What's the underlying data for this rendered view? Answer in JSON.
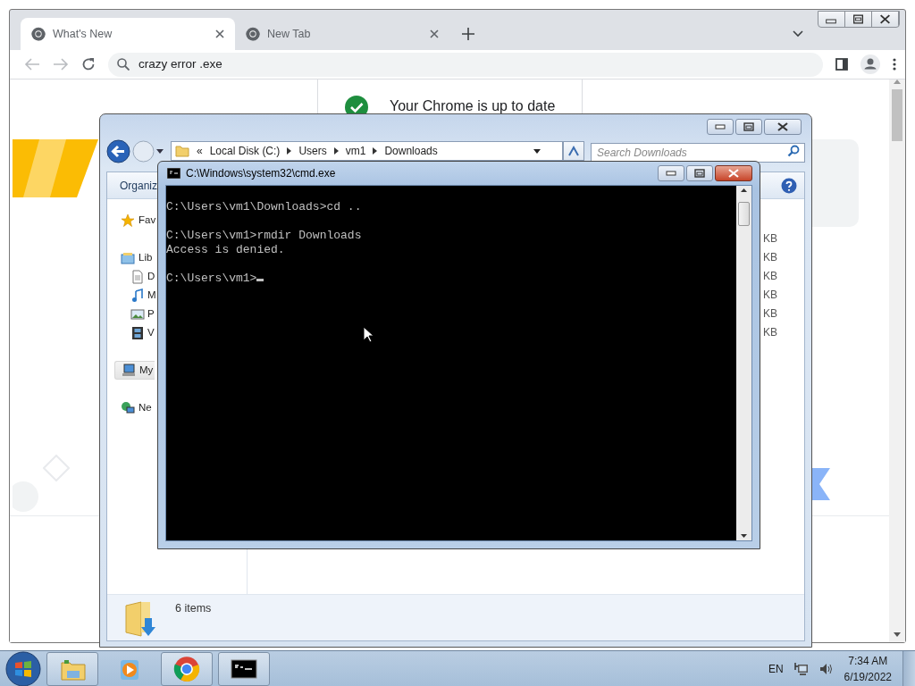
{
  "chrome": {
    "tabs": [
      {
        "label": "What's New",
        "selected": true
      },
      {
        "label": "New Tab",
        "selected": false
      }
    ],
    "omnibox": "crazy error .exe",
    "update_status": "Your Chrome is up to date"
  },
  "explorer": {
    "breadcrumb_overflow": "«",
    "breadcrumb": [
      "Local Disk (C:)",
      "Users",
      "vm1",
      "Downloads"
    ],
    "search": {
      "placeholder": "Search Downloads"
    },
    "toolbar": "Organiz",
    "nav": [
      {
        "label": "Fav",
        "kind": "star",
        "selected": false
      },
      {
        "label": "Lib",
        "kind": "library",
        "selected": false,
        "children": [
          {
            "label": "D",
            "kind": "document",
            "selected": false
          },
          {
            "label": "M",
            "kind": "music",
            "selected": false
          },
          {
            "label": "P",
            "kind": "picture",
            "selected": false
          },
          {
            "label": "V",
            "kind": "video",
            "selected": false
          }
        ]
      },
      {
        "label": "My",
        "kind": "computer",
        "selected": true
      },
      {
        "label": "Ne",
        "kind": "network",
        "selected": false
      }
    ],
    "sizes": [
      "KB",
      "KB",
      "KB",
      "KB",
      "KB",
      "KB"
    ],
    "status": "6 items"
  },
  "cmd": {
    "title": "C:\\Windows\\system32\\cmd.exe",
    "blocks": [
      [
        "C:\\Users\\vm1\\Downloads>cd .."
      ],
      [
        "C:\\Users\\vm1>rmdir Downloads",
        "Access is denied."
      ],
      [
        "C:\\Users\\vm1>"
      ]
    ]
  },
  "taskbar": {
    "apps": [
      {
        "kind": "explorer",
        "running": true
      },
      {
        "kind": "media",
        "running": false
      },
      {
        "kind": "chrome",
        "running": true
      },
      {
        "kind": "cmd",
        "running": true
      }
    ],
    "language": "EN",
    "time": "7:34 AM",
    "date": "6/19/2022"
  }
}
